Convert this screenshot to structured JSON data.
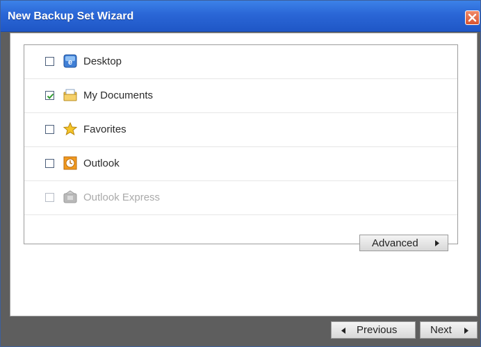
{
  "window": {
    "title": "New Backup Set Wizard"
  },
  "items": [
    {
      "label": "Desktop",
      "checked": false,
      "enabled": true,
      "icon": "desktop-icon"
    },
    {
      "label": "My Documents",
      "checked": true,
      "enabled": true,
      "icon": "folder-icon"
    },
    {
      "label": "Favorites",
      "checked": false,
      "enabled": true,
      "icon": "star-icon"
    },
    {
      "label": "Outlook",
      "checked": false,
      "enabled": true,
      "icon": "outlook-clock-icon"
    },
    {
      "label": "Outlook Express",
      "checked": false,
      "enabled": false,
      "icon": "outlook-express-icon"
    }
  ],
  "buttons": {
    "advanced": "Advanced",
    "previous": "Previous",
    "next": "Next"
  },
  "colors": {
    "titlebar": "#2a66d6",
    "close": "#d8532f",
    "frame": "#5e5e5e"
  }
}
